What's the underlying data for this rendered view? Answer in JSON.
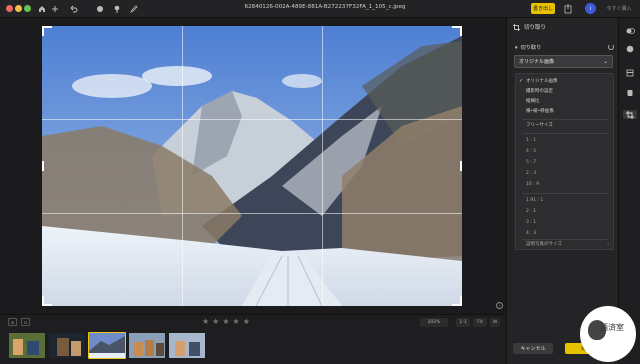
{
  "toolbar": {
    "filename": "62840126-002A-489E-881A-B272237F32FA_1_105_c.jpeg",
    "done_label": "書き出し",
    "upgrade_label": "今すぐ購入",
    "avatar_initial": "i",
    "traffic_lights": [
      "#ed6a5e",
      "#f5bf4f",
      "#61c554"
    ],
    "icons": [
      "sidebar-icon",
      "home-icon",
      "add-icon",
      "undo-icon",
      "mask-icon",
      "brush-icon",
      "pen-icon"
    ]
  },
  "canvas": {
    "info_symbol": "i"
  },
  "filmbar": {
    "left_buttons": [
      "⊞",
      "⊡"
    ],
    "rating": 0,
    "stars": [
      "★",
      "★",
      "★",
      "★",
      "★"
    ],
    "zoom": "202%",
    "view_buttons": [
      "1:1",
      "Fit",
      "⊟"
    ],
    "thumbnails": 5,
    "selected_thumbnail": 3
  },
  "panel": {
    "title": "切り取り",
    "section_title": "切り取り",
    "selected_ratio": "オリジナル画像",
    "menu": {
      "items_group1": [
        "オリジナル画像",
        "撮影時の設定",
        "縦横比",
        "横•縦•幹画像"
      ],
      "checked_index": 0,
      "freesize": "フリーサイズ",
      "ratios": [
        "1 : 1",
        "4 : 5",
        "5 : 7",
        "2 : 3",
        "16 : 9"
      ],
      "ratios2": [
        "1.91 : 1",
        "2 : 1",
        "3 : 1",
        "4 : 3"
      ],
      "passport": "証明写真のサイズ"
    },
    "cancel_label": "キャンセル",
    "apply_label": "適用"
  },
  "watermark": {
    "text": "酒済室"
  },
  "colors": {
    "accent": "#e6c200",
    "background": "#1b1b1d",
    "panel": "#242426"
  }
}
